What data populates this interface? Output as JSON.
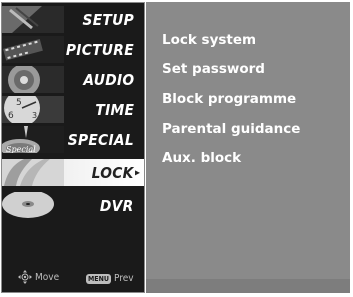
{
  "menu": {
    "items": [
      {
        "label": "SETUP",
        "icon": "setup-thumb-icon"
      },
      {
        "label": "PICTURE",
        "icon": "picture-thumb-icon"
      },
      {
        "label": "AUDIO",
        "icon": "audio-thumb-icon"
      },
      {
        "label": "TIME",
        "icon": "time-thumb-icon"
      },
      {
        "label": "SPECIAL",
        "icon": "special-thumb-icon"
      },
      {
        "label": "LOCK",
        "icon": "lock-thumb-icon",
        "selected": true
      },
      {
        "label": "DVR",
        "icon": "dvr-thumb-icon"
      }
    ],
    "selected_index": 5
  },
  "hints": {
    "move_label": "Move",
    "menu_badge": "MENU",
    "prev_label": "Prev"
  },
  "submenu": {
    "options": [
      {
        "label": "Lock system"
      },
      {
        "label": "Set password"
      },
      {
        "label": "Block programme"
      },
      {
        "label": "Parental guidance"
      },
      {
        "label": "Aux. block"
      }
    ]
  },
  "colors": {
    "sidebar_bg": "#1a1a1a",
    "panel_bg": "#8a8a8a",
    "selected_bg": "#f0f0f0",
    "text": "#ffffff"
  }
}
